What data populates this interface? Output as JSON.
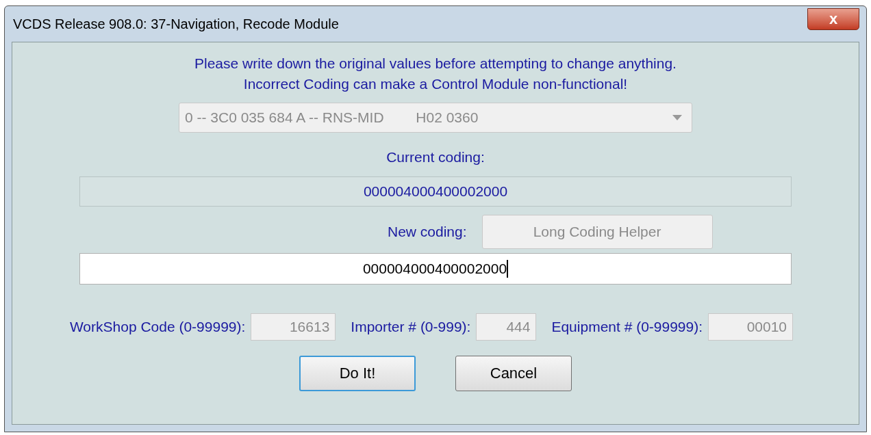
{
  "window": {
    "title": "VCDS Release 908.0: 37-Navigation,  Recode Module",
    "close": "x"
  },
  "warning": [
    "Please write down the original values before attempting to change anything.",
    "Incorrect Coding can make a Control Module non-functional!"
  ],
  "module_select": {
    "value": "0 -- 3C0 035 684 A -- RNS-MID        H02 0360",
    "disabled": true
  },
  "current_coding": {
    "label": "Current coding:",
    "value": "000004000400002000"
  },
  "new_coding": {
    "label": "New coding:",
    "value": "000004000400002000",
    "helper_button": {
      "label": "Long Coding Helper",
      "disabled": true
    }
  },
  "fields": [
    {
      "label": "WorkShop Code (0-99999):",
      "value": "16613",
      "disabled": true
    },
    {
      "label": "Importer # (0-999):",
      "value": "444",
      "disabled": true
    },
    {
      "label": "Equipment # (0-99999):",
      "value": "00010",
      "disabled": true
    }
  ],
  "buttons": [
    {
      "label": "Do It!",
      "default": true
    },
    {
      "label": "Cancel",
      "default": false
    }
  ]
}
